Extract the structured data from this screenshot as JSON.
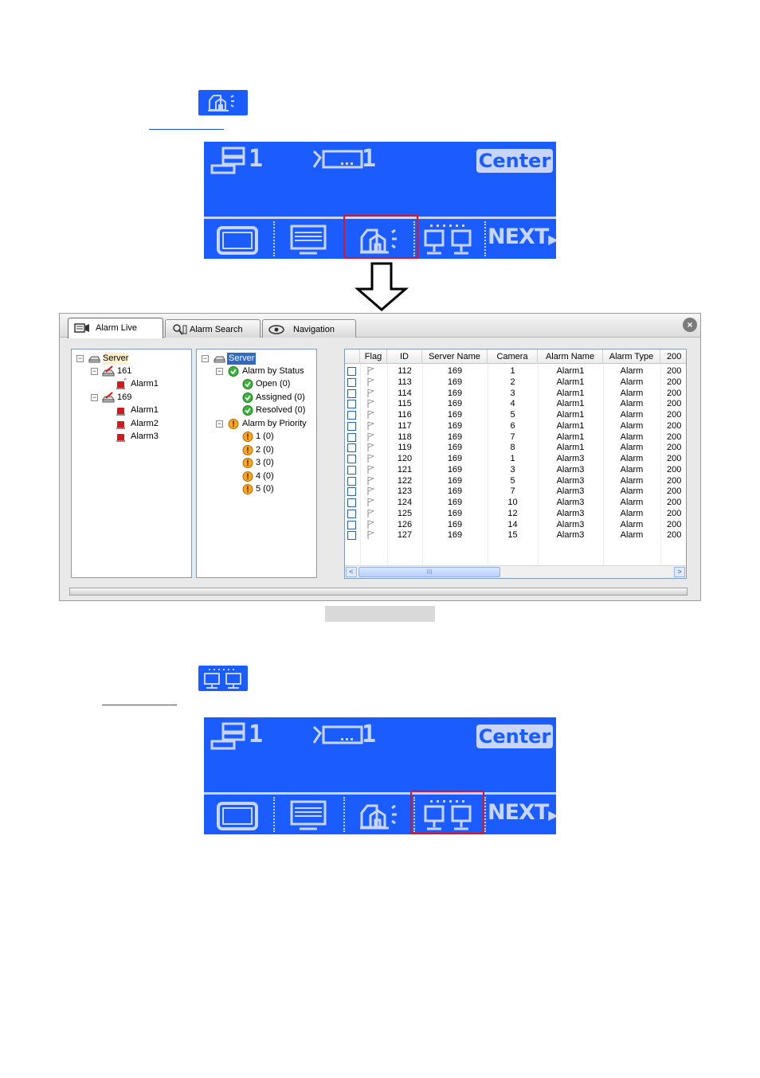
{
  "lcd_panels": [
    {
      "server_count": "1",
      "camera_count": "1",
      "center_label": "Center",
      "next_label": "NEXT",
      "selected_button": "alarm"
    },
    {
      "server_count": "1",
      "camera_count": "1",
      "center_label": "Center",
      "next_label": "NEXT",
      "selected_button": "network"
    }
  ],
  "icons": {
    "lcd_buttons": [
      "single-view-icon",
      "monitor-icon",
      "alarm-icon",
      "network-icon",
      "next-arrow-icon"
    ],
    "header": [
      "server-icon",
      "camera-icon"
    ]
  },
  "colors": {
    "lcd_blue": "#1b5cff",
    "lcd_segment": "#c8d6ff",
    "selection_red": "#e0141e",
    "tree_highlight": "#316ac5"
  },
  "window": {
    "tabs": [
      {
        "label": "Alarm Live",
        "active": true
      },
      {
        "label": "Alarm Search",
        "active": false
      },
      {
        "label": "Navigation",
        "active": false
      }
    ],
    "close_label": "×",
    "server_tree": {
      "root": "Server",
      "servers": [
        {
          "name": "161",
          "alarms": [
            "Alarm1"
          ]
        },
        {
          "name": "169",
          "alarms": [
            "Alarm1",
            "Alarm2",
            "Alarm3"
          ]
        }
      ]
    },
    "status_tree": {
      "root": "Server",
      "status_group": "Alarm by Status",
      "status_items": [
        "Open (0)",
        "Assigned (0)",
        "Resolved (0)"
      ],
      "priority_group": "Alarm by Priority",
      "priority_items": [
        "1 (0)",
        "2 (0)",
        "3 (0)",
        "4 (0)",
        "5 (0)"
      ]
    },
    "grid": {
      "columns": [
        "Flag",
        "ID",
        "Server Name",
        "Camera",
        "Alarm Name",
        "Alarm Type",
        "200"
      ],
      "rows": [
        [
          "112",
          "169",
          "1",
          "Alarm1",
          "Alarm",
          "200"
        ],
        [
          "113",
          "169",
          "2",
          "Alarm1",
          "Alarm",
          "200"
        ],
        [
          "114",
          "169",
          "3",
          "Alarm1",
          "Alarm",
          "200"
        ],
        [
          "115",
          "169",
          "4",
          "Alarm1",
          "Alarm",
          "200"
        ],
        [
          "116",
          "169",
          "5",
          "Alarm1",
          "Alarm",
          "200"
        ],
        [
          "117",
          "169",
          "6",
          "Alarm1",
          "Alarm",
          "200"
        ],
        [
          "118",
          "169",
          "7",
          "Alarm1",
          "Alarm",
          "200"
        ],
        [
          "119",
          "169",
          "8",
          "Alarm1",
          "Alarm",
          "200"
        ],
        [
          "120",
          "169",
          "1",
          "Alarm3",
          "Alarm",
          "200"
        ],
        [
          "121",
          "169",
          "3",
          "Alarm3",
          "Alarm",
          "200"
        ],
        [
          "122",
          "169",
          "5",
          "Alarm3",
          "Alarm",
          "200"
        ],
        [
          "123",
          "169",
          "7",
          "Alarm3",
          "Alarm",
          "200"
        ],
        [
          "124",
          "169",
          "10",
          "Alarm3",
          "Alarm",
          "200"
        ],
        [
          "125",
          "169",
          "12",
          "Alarm3",
          "Alarm",
          "200"
        ],
        [
          "126",
          "169",
          "14",
          "Alarm3",
          "Alarm",
          "200"
        ],
        [
          "127",
          "169",
          "15",
          "Alarm3",
          "Alarm",
          "200"
        ]
      ],
      "scroll_left": "<",
      "scroll_right": ">",
      "scroll_thumb": "III"
    }
  }
}
